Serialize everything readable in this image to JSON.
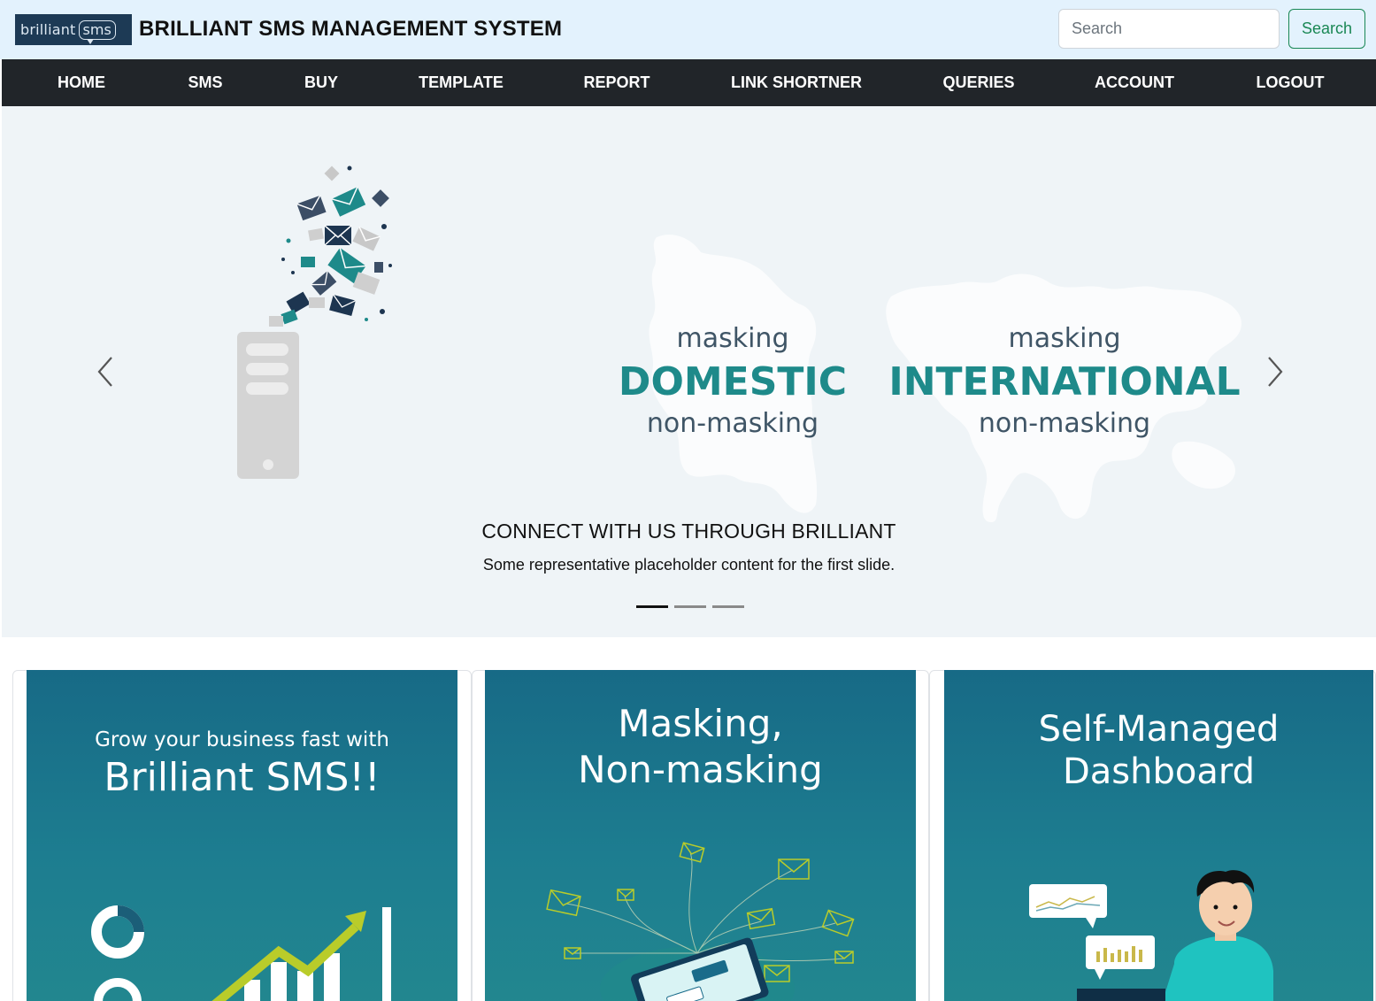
{
  "header": {
    "logo_text_brilliant": "brilliant",
    "logo_text_sms": "sms",
    "title": "BRILLIANT SMS MANAGEMENT SYSTEM",
    "search_placeholder": "Search",
    "search_button": "Search"
  },
  "nav": {
    "items": [
      {
        "label": "HOME"
      },
      {
        "label": "SMS"
      },
      {
        "label": "BUY"
      },
      {
        "label": "TEMPLATE"
      },
      {
        "label": "REPORT"
      },
      {
        "label": "LINK SHORTNER"
      },
      {
        "label": "QUERIES"
      },
      {
        "label": "ACCOUNT"
      },
      {
        "label": "LOGOUT"
      }
    ]
  },
  "carousel": {
    "slide_art": {
      "domestic_top": "masking",
      "domestic_main": "DOMESTIC",
      "domestic_bottom": "non-masking",
      "international_top": "masking",
      "international_main": "INTERNATIONAL",
      "international_bottom": "non-masking"
    },
    "caption_title": "CONNECT WITH US THROUGH BRILLIANT",
    "caption_text": "Some representative placeholder content for the first slide.",
    "indicator_count": 3,
    "active_index": 0,
    "prev_icon": "chevron-left-icon",
    "next_icon": "chevron-right-icon"
  },
  "cards": [
    {
      "line1": "Grow your business fast with",
      "line2": "Brilliant SMS!!"
    },
    {
      "line1": "Masking,",
      "line2": "Non-masking"
    },
    {
      "line1": "Self-Managed",
      "line2": "Dashboard"
    }
  ],
  "colors": {
    "header_bg": "#e3f2fd",
    "nav_bg": "#212529",
    "search_green": "#198754",
    "teal_text": "#1e8a8a",
    "card_teal": "#1a7589"
  }
}
